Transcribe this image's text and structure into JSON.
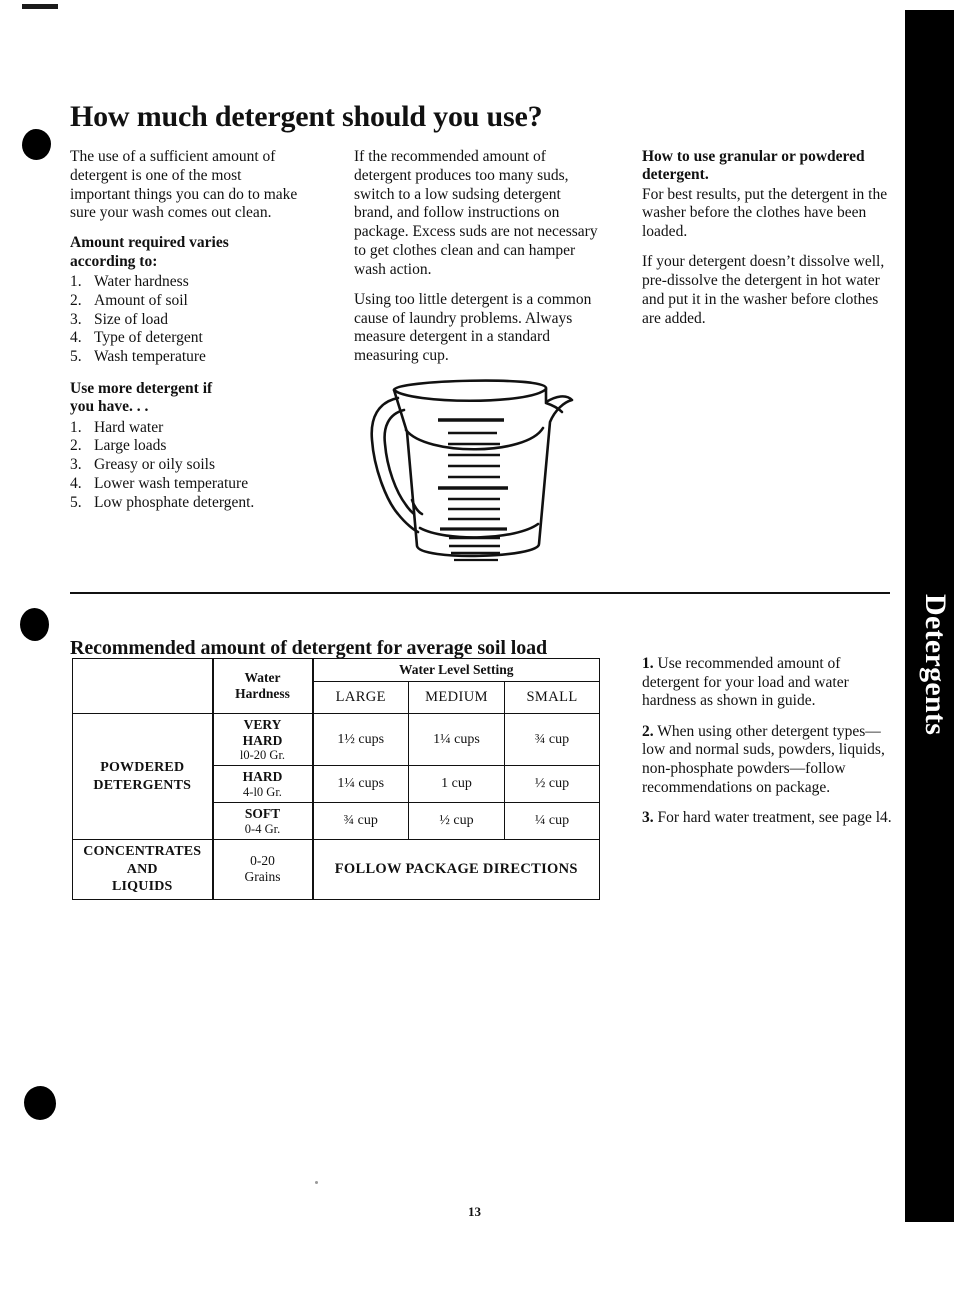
{
  "page": {
    "title": "How much detergent should you use?",
    "number": "13",
    "side_tab_label": "Detergents"
  },
  "column_1": {
    "intro": "The use of a sufficient amount of detergent is one of the most important things you can do to make sure your wash comes out clean.",
    "subhead_1_line_1": "Amount required varies",
    "subhead_1_line_2": "according to:",
    "list_1": [
      {
        "num": "1.",
        "text": "Water hardness"
      },
      {
        "num": "2.",
        "text": "Amount of soil"
      },
      {
        "num": "3.",
        "text": "Size of load"
      },
      {
        "num": "4.",
        "text": "Type of detergent"
      },
      {
        "num": "5.",
        "text": "Wash temperature"
      }
    ],
    "subhead_2_line_1": "Use more detergent if",
    "subhead_2_line_2": "you have. . .",
    "list_2": [
      {
        "num": "1.",
        "text": "Hard water"
      },
      {
        "num": "2.",
        "text": "Large loads"
      },
      {
        "num": "3.",
        "text": "Greasy or oily soils"
      },
      {
        "num": "4.",
        "text": "Lower wash temperature"
      },
      {
        "num": "5.",
        "text": "Low phosphate detergent."
      }
    ]
  },
  "column_2": {
    "para_1": "If the recommended amount of detergent produces too many suds, switch to a low sudsing detergent brand, and follow instructions on package. Excess suds are not necessary to get clothes clean and can hamper wash action.",
    "para_2": "Using too little detergent is a common cause of laundry problems. Always measure detergent in a standard measuring cup.",
    "figure_name": "measuring-cup-illustration"
  },
  "column_3": {
    "subhead_line_1": "How to use granular or powdered",
    "subhead_line_2": "detergent.",
    "para_1": "For best results, put the detergent in the washer before the clothes have been loaded.",
    "para_2": "If your detergent doesn’t dissolve well, pre-dissolve the detergent in hot water and put it in the washer before clothes are added."
  },
  "table_section": {
    "heading": "Recommended amount of detergent for average soil load",
    "table": {
      "group_header": "Water Level Setting",
      "hardness_header_line_1": "Water",
      "hardness_header_line_2": "Hardness",
      "level_columns": [
        "LARGE",
        "MEDIUM",
        "SMALL"
      ],
      "row_group_1_label_line_1": "POWDERED",
      "row_group_1_label_line_2": "DETERGENTS",
      "rows": [
        {
          "hardness_name": "VERY HARD",
          "hardness_line_1": "VERY",
          "hardness_line_2": "HARD",
          "grains": "l0-20 Gr.",
          "large": "1½ cups",
          "medium": "1¼ cups",
          "small": "¾ cup"
        },
        {
          "hardness_name": "HARD",
          "hardness_line_1": "HARD",
          "hardness_line_2": "",
          "grains": "4-l0 Gr.",
          "large": "1¼ cups",
          "medium": "1 cup",
          "small": "½ cup"
        },
        {
          "hardness_name": "SOFT",
          "hardness_line_1": "SOFT",
          "hardness_line_2": "",
          "grains": "0-4 Gr.",
          "large": "¾ cup",
          "medium": "½ cup",
          "small": "¼ cup"
        }
      ],
      "row_group_2_label_line_1": "CONCENTRATES",
      "row_group_2_label_line_2": "AND",
      "row_group_2_label_line_3": "LIQUIDS",
      "row_group_2_grains_line_1": "0-20",
      "row_group_2_grains_line_2": "Grains",
      "row_group_2_value": "FOLLOW PACKAGE DIRECTIONS"
    },
    "guide": [
      {
        "num": "1.",
        "text": "Use recommended amount of detergent for your load and water hardness as shown in guide."
      },
      {
        "num": "2.",
        "text": "When using other detergent types—low and normal suds, powders, liquids, non-phosphate powders—follow recommendations on package."
      },
      {
        "num": "3.",
        "text": "For hard water treatment, see page l4."
      }
    ]
  },
  "colors": {
    "ink": "#111111",
    "tab_background": "#000000",
    "tab_text": "#ffffff",
    "paper": "#ffffff"
  }
}
